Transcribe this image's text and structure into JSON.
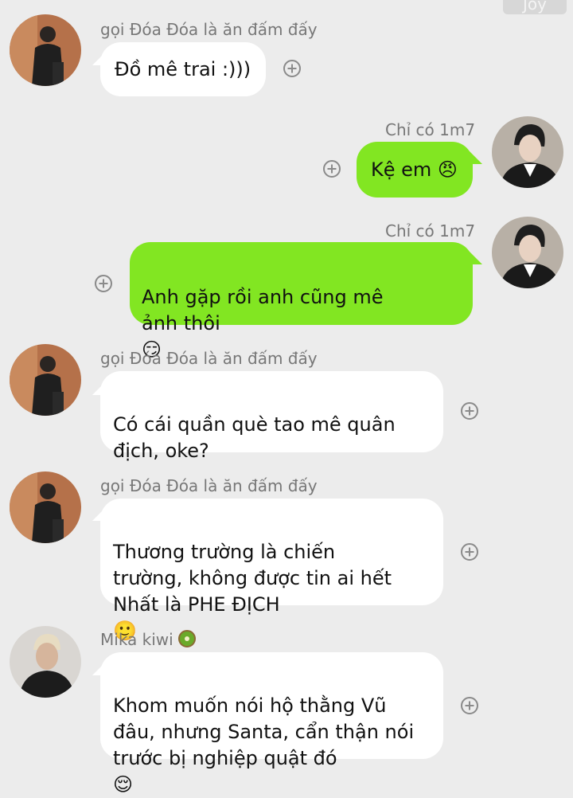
{
  "watermark": "Joy",
  "messages": [
    {
      "sender": "gọi Đóa Đóa là ăn đấm đấy",
      "text": "Đồ mê trai :)))",
      "emoji": ""
    },
    {
      "sender": "Chỉ có 1m7",
      "text": "Kệ em",
      "emoji": "😠"
    },
    {
      "sender": "Chỉ có 1m7",
      "text": "Anh gặp rồi anh cũng mê\nảnh thôi",
      "emoji": "😏"
    },
    {
      "sender": "gọi Đóa Đóa là ăn đấm đấy",
      "text": "Có cái quần què tao mê quân\nđịch, oke?",
      "emoji": ""
    },
    {
      "sender": "gọi Đóa Đóa là ăn đấm đấy",
      "text": "Thương trường là chiến\ntrường, không được tin ai hết\nNhất là PHE ĐỊCH",
      "emoji": "🙂"
    },
    {
      "sender": "Mika kiwi",
      "text": "Khom muốn nói hộ thằng Vũ\nđâu, nhưng Santa, cẩn thận nói\ntrước bị nghiệp quật đó",
      "emoji": "😌"
    }
  ],
  "icons": {
    "add": "plus-circle-icon",
    "sender_badge": "kiwi-icon"
  },
  "colors": {
    "background": "#ececec",
    "incoming_bubble": "#ffffff",
    "outgoing_bubble": "#82e622",
    "sender_name": "#777777"
  }
}
